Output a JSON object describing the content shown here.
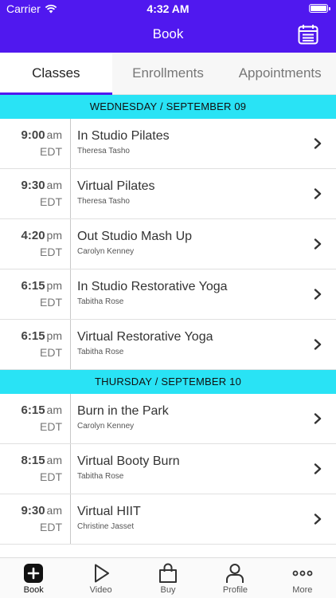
{
  "status_bar": {
    "carrier": "Carrier",
    "time": "4:32 AM"
  },
  "header": {
    "title": "Book",
    "calendar_icon": "calendar-icon"
  },
  "tabs": [
    {
      "label": "Classes",
      "active": true
    },
    {
      "label": "Enrollments",
      "active": false
    },
    {
      "label": "Appointments",
      "active": false
    }
  ],
  "days": [
    {
      "label": "WEDNESDAY / SEPTEMBER 09",
      "classes": [
        {
          "time": "9:00",
          "ampm": "am",
          "tz": "EDT",
          "name": "In Studio Pilates",
          "instructor": "Theresa Tasho"
        },
        {
          "time": "9:30",
          "ampm": "am",
          "tz": "EDT",
          "name": "Virtual Pilates",
          "instructor": "Theresa Tasho"
        },
        {
          "time": "4:20",
          "ampm": "pm",
          "tz": "EDT",
          "name": "Out Studio Mash Up",
          "instructor": "Carolyn Kenney"
        },
        {
          "time": "6:15",
          "ampm": "pm",
          "tz": "EDT",
          "name": "In Studio Restorative Yoga",
          "instructor": "Tabitha Rose"
        },
        {
          "time": "6:15",
          "ampm": "pm",
          "tz": "EDT",
          "name": "Virtual Restorative Yoga",
          "instructor": "Tabitha Rose"
        }
      ]
    },
    {
      "label": "THURSDAY / SEPTEMBER 10",
      "classes": [
        {
          "time": "6:15",
          "ampm": "am",
          "tz": "EDT",
          "name": "Burn in the Park",
          "instructor": "Carolyn Kenney"
        },
        {
          "time": "8:15",
          "ampm": "am",
          "tz": "EDT",
          "name": "Virtual Booty Burn",
          "instructor": "Tabitha Rose"
        },
        {
          "time": "9:30",
          "ampm": "am",
          "tz": "EDT",
          "name": "Virtual HIIT",
          "instructor": "Christine Jasset"
        }
      ]
    }
  ],
  "tab_bar": [
    {
      "label": "Book",
      "icon": "plus-square-icon",
      "active": true
    },
    {
      "label": "Video",
      "icon": "play-icon",
      "active": false
    },
    {
      "label": "Buy",
      "icon": "shopping-bag-icon",
      "active": false
    },
    {
      "label": "Profile",
      "icon": "person-icon",
      "active": false
    },
    {
      "label": "More",
      "icon": "more-dots-icon",
      "active": false
    }
  ],
  "colors": {
    "header": "#5018ef",
    "day_band": "#29e3f5",
    "tab_indicator": "#5018ef"
  }
}
